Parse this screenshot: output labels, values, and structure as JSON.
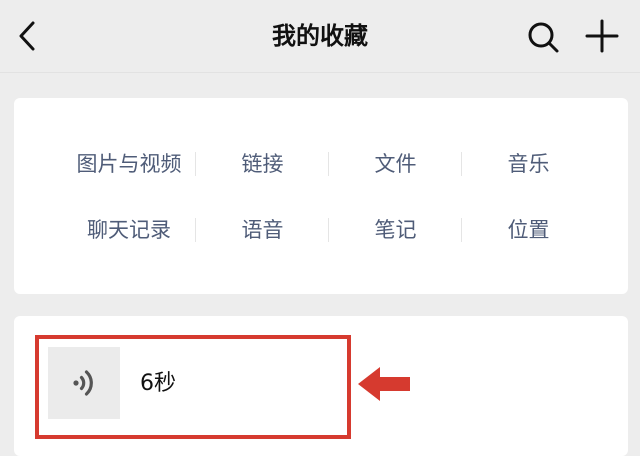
{
  "nav": {
    "title": "我的收藏",
    "back_icon": "chevron-left-icon",
    "search_icon": "search-icon",
    "add_icon": "plus-icon"
  },
  "categories": [
    [
      "图片与视频",
      "链接",
      "文件",
      "音乐"
    ],
    [
      "聊天记录",
      "语音",
      "笔记",
      "位置"
    ]
  ],
  "favorite_item": {
    "type": "voice",
    "icon": "voice-wave-icon",
    "duration": "6秒"
  },
  "annotation": {
    "box_color": "#d63a2f",
    "arrow_icon": "left-arrow-icon",
    "arrow_color": "#d63a2f"
  },
  "colors": {
    "background": "#ededed",
    "card": "#ffffff",
    "category_text": "#4f5c78",
    "title_text": "#111111"
  }
}
